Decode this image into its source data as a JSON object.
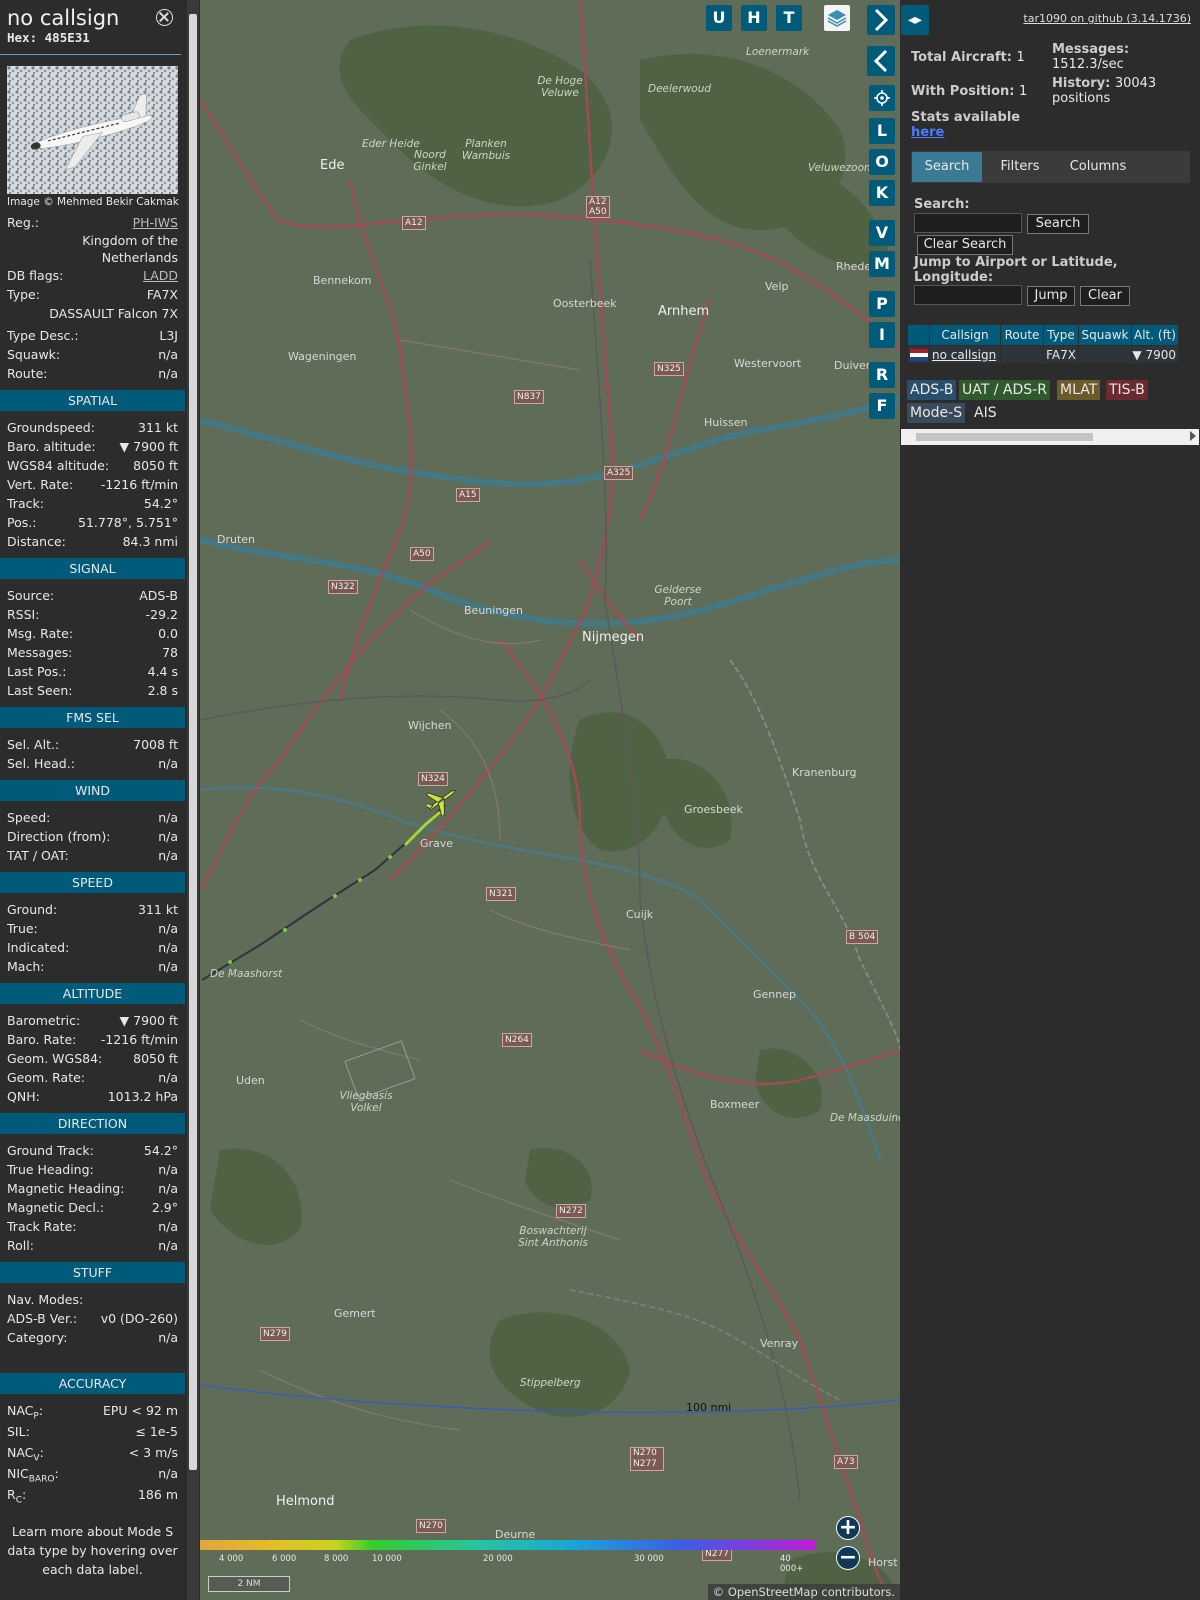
{
  "info": {
    "callsign": "no callsign",
    "hex_label": "Hex:",
    "hex": "485E31",
    "image_credit": "Image © Mehmed Bekir Cakmak",
    "reg_label": "Reg.:",
    "reg": "PH-IWS",
    "country_line1": "Kingdom of the",
    "country_line2": "Netherlands",
    "dbflags_label": "DB flags:",
    "dbflags": "LADD",
    "type_label": "Type:",
    "type": "FA7X",
    "type_name": "DASSAULT Falcon 7X",
    "typedesc_label": "Type Desc.:",
    "typedesc": "L3J",
    "squawk_label": "Squawk:",
    "squawk": "n/a",
    "route_label": "Route:",
    "route": "n/a"
  },
  "sections": {
    "spatial": {
      "title": "SPATIAL",
      "rows": [
        {
          "label": "Groundspeed:",
          "value": "311 kt"
        },
        {
          "label": "Baro. altitude:",
          "value": "▼ 7900 ft"
        },
        {
          "label": "WGS84 altitude:",
          "value": "8050 ft"
        },
        {
          "label": "Vert. Rate:",
          "value": "-1216 ft/min"
        },
        {
          "label": "Track:",
          "value": "54.2°"
        },
        {
          "label": "Pos.:",
          "value": "51.778°, 5.751°"
        },
        {
          "label": "Distance:",
          "value": "84.3 nmi"
        }
      ]
    },
    "signal": {
      "title": "SIGNAL",
      "rows": [
        {
          "label": "Source:",
          "value": "ADS-B"
        },
        {
          "label": "RSSI:",
          "value": "-29.2"
        },
        {
          "label": "Msg. Rate:",
          "value": "0.0"
        },
        {
          "label": "Messages:",
          "value": "78"
        },
        {
          "label": "Last Pos.:",
          "value": "4.4 s"
        },
        {
          "label": "Last Seen:",
          "value": "2.8 s"
        }
      ]
    },
    "fms": {
      "title": "FMS SEL",
      "rows": [
        {
          "label": "Sel. Alt.:",
          "value": "7008 ft"
        },
        {
          "label": "Sel. Head.:",
          "value": "n/a"
        }
      ]
    },
    "wind": {
      "title": "WIND",
      "rows": [
        {
          "label": "Speed:",
          "value": "n/a"
        },
        {
          "label": "Direction (from):",
          "value": "n/a"
        },
        {
          "label": "TAT / OAT:",
          "value": "n/a"
        }
      ]
    },
    "speed": {
      "title": "SPEED",
      "rows": [
        {
          "label": "Ground:",
          "value": "311 kt"
        },
        {
          "label": "True:",
          "value": "n/a"
        },
        {
          "label": "Indicated:",
          "value": "n/a"
        },
        {
          "label": "Mach:",
          "value": "n/a"
        }
      ]
    },
    "altitude": {
      "title": "ALTITUDE",
      "rows": [
        {
          "label": "Barometric:",
          "value": "▼ 7900 ft"
        },
        {
          "label": "Baro. Rate:",
          "value": "-1216 ft/min"
        },
        {
          "label": "Geom. WGS84:",
          "value": "8050 ft"
        },
        {
          "label": "Geom. Rate:",
          "value": "n/a"
        },
        {
          "label": "QNH:",
          "value": "1013.2 hPa"
        }
      ]
    },
    "direction": {
      "title": "DIRECTION",
      "rows": [
        {
          "label": "Ground Track:",
          "value": "54.2°"
        },
        {
          "label": "True Heading:",
          "value": "n/a"
        },
        {
          "label": "Magnetic Heading:",
          "value": "n/a"
        },
        {
          "label": "Magnetic Decl.:",
          "value": "2.9°"
        },
        {
          "label": "Track Rate:",
          "value": "n/a"
        },
        {
          "label": "Roll:",
          "value": "n/a"
        }
      ]
    },
    "stuff": {
      "title": "STUFF",
      "rows": [
        {
          "label": "Nav. Modes:",
          "value": ""
        },
        {
          "label": "ADS-B Ver.:",
          "value": "v0 (DO-260)"
        },
        {
          "label": "Category:",
          "value": "n/a"
        }
      ]
    },
    "accuracy": {
      "title": "ACCURACY",
      "rows": [
        {
          "label": "NAC",
          "sub": "P",
          "value": "EPU < 92 m"
        },
        {
          "label": "SIL:",
          "sub": "",
          "value": "≤ 1e-5"
        },
        {
          "label": "NAC",
          "sub": "V",
          "value": "< 3 m/s"
        },
        {
          "label": "NIC",
          "sub": "BARO",
          "value": "n/a"
        },
        {
          "label": "R",
          "sub": "C",
          "value": "186 m"
        }
      ]
    },
    "footer_note": "Learn more about Mode S data type by hovering over each data label."
  },
  "map": {
    "places": [
      "Ede",
      "Bennekom",
      "Wageningen",
      "Oosterbeek",
      "Arnhem",
      "Velp",
      "Westervoort",
      "Duiven",
      "Huissen",
      "Druten",
      "Beuningen",
      "Nijmegen",
      "Wijchen",
      "Groesbeek",
      "Kranenburg",
      "Grave",
      "Cuijk",
      "Gennep",
      "Uden",
      "Boxmeer",
      "Gemert",
      "Venray",
      "Helmond",
      "Deurne",
      "Rhede",
      "Horst"
    ],
    "nature": [
      "De Hoge Veluwe",
      "Deelerwoud",
      "Loenermark",
      "Eder Heide",
      "Planken Wambuis",
      "Noord Ginkel",
      "Veluwezoom",
      "Gelderse Poort",
      "De Maashorst",
      "Vliegbasis Volkel",
      "Boswachterij Sint Anthonis",
      "De Maasduinen",
      "Stippelberg"
    ],
    "roads": [
      "A12",
      "A12 A50",
      "A50",
      "A15",
      "A325",
      "N325",
      "N837",
      "N322",
      "N324",
      "N321",
      "N264",
      "N272",
      "N279",
      "N270",
      "N270 N277",
      "N277",
      "A73",
      "B 504"
    ],
    "range_ring": "100 nmi",
    "scale": "2 NM",
    "altitude_legend": [
      "4 000",
      "6 000",
      "8 000",
      "10 000",
      "20 000",
      "30 000",
      "40 000+"
    ],
    "attribution": "© OpenStreetMap contributors.",
    "buttons": [
      "U",
      "H",
      "T",
      "L",
      "O",
      "K",
      "V",
      "M",
      "P",
      "I",
      "R",
      "F"
    ]
  },
  "sidebar": {
    "github": "tar1090 on github (3.14.1736)",
    "total_label": "Total Aircraft:",
    "total": "1",
    "withpos_label": "With Position:",
    "withpos": "1",
    "messages_label": "Messages:",
    "messages": "1512.3/sec",
    "history_label": "History:",
    "history": "30043 positions",
    "stats_label": "Stats available",
    "stats_link": "here",
    "tabs": [
      "Search",
      "Filters",
      "Columns"
    ],
    "search_label": "Search:",
    "search_btn": "Search",
    "clear_search_btn": "Clear Search",
    "jump_label": "Jump to Airport or Latitude, Longitude:",
    "jump_btn": "Jump",
    "clear_btn": "Clear",
    "columns": [
      "Callsign",
      "Route",
      "Type",
      "Squawk",
      "Alt. (ft)"
    ],
    "row": {
      "callsign": "no callsign",
      "route": "",
      "type": "FA7X",
      "squawk": "",
      "alt": "▼ 7900"
    },
    "sources": [
      "ADS-B",
      "UAT / ADS-R",
      "MLAT",
      "TIS-B",
      "Mode-S",
      "AIS"
    ]
  }
}
